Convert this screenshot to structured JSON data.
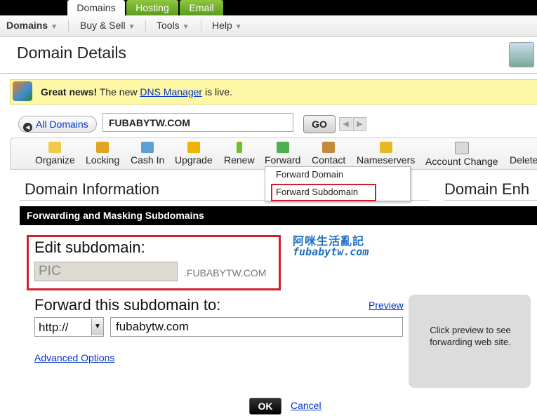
{
  "top_tabs": [
    {
      "label": "Domains"
    },
    {
      "label": "Hosting"
    },
    {
      "label": "Email"
    }
  ],
  "menu": [
    {
      "label": "Domains"
    },
    {
      "label": "Buy & Sell"
    },
    {
      "label": "Tools"
    },
    {
      "label": "Help"
    }
  ],
  "page_title": "Domain Details",
  "news": {
    "bold": "Great news!",
    "text_before": " The new ",
    "link": "DNS Manager",
    "text_after": " is live."
  },
  "search": {
    "all_domains": "All Domains",
    "domain_value": "FUBABYTW.COM",
    "go_label": "GO"
  },
  "toolbar": [
    {
      "label": "Organize",
      "icon": "folder-icon",
      "color": "#f2c94c"
    },
    {
      "label": "Locking",
      "icon": "lock-icon",
      "color": "#e2a521"
    },
    {
      "label": "Cash In",
      "icon": "cash-icon",
      "color": "#5aa0d8"
    },
    {
      "label": "Upgrade",
      "icon": "badge-icon",
      "color": "#f0b400"
    },
    {
      "label": "Renew",
      "icon": "exclamation-icon",
      "color": "#6fbf2a"
    },
    {
      "label": "Forward",
      "icon": "forward-arrow-icon",
      "color": "#4caf50"
    },
    {
      "label": "Contact",
      "icon": "person-icon",
      "color": "#c28a3a"
    },
    {
      "label": "Nameservers",
      "icon": "database-icon",
      "color": "#e6b822"
    },
    {
      "label": "Account Change",
      "icon": "pencil-icon",
      "color": "#d9d9d9"
    },
    {
      "label": "Delete",
      "icon": "",
      "color": ""
    }
  ],
  "forward_dropdown": {
    "items": [
      {
        "label": "Forward Domain"
      },
      {
        "label": "Forward Subdomain"
      }
    ]
  },
  "sections": {
    "domain_information": "Domain Information",
    "domain_enh": "Domain Enh"
  },
  "panel": {
    "title": "Forwarding and Masking Subdomains",
    "edit_label": "Edit subdomain:",
    "subdomain_value": "PIC",
    "suffix": ".FUBABYTW.COM",
    "watermark_line1": "阿咪生活亂記",
    "watermark_line2": "fubabytw.com",
    "forward_label": "Forward this subdomain to:",
    "preview_link": "Preview",
    "protocol": "http://",
    "target_value": "fubabytw.com",
    "advanced_options": "Advanced Options",
    "preview_text": "Click preview to see forwarding web site.",
    "ok_label": "OK",
    "cancel_label": "Cancel"
  },
  "colors": {
    "highlight_red": "#d01f2a",
    "link_blue": "#0033cc",
    "tab_green": "#6aaa25",
    "news_yellow": "#fdf7a6"
  }
}
